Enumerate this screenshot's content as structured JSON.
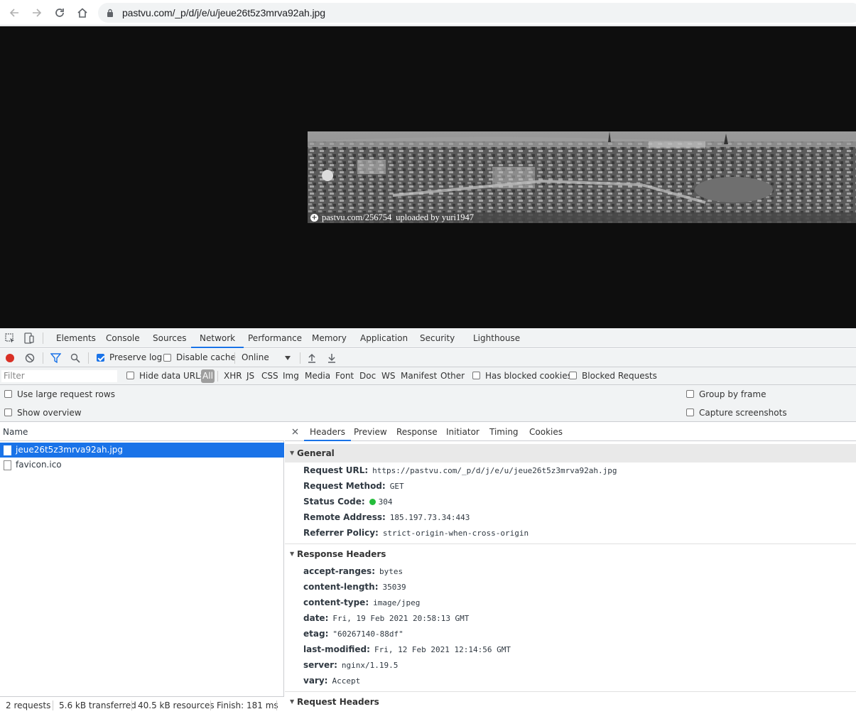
{
  "browser": {
    "url": "pastvu.com/_p/d/j/e/u/jeue26t5z3mrva92ah.jpg"
  },
  "photo": {
    "caption_site": "pastvu.com/256754",
    "caption_uploader": "uploaded by yuri1947"
  },
  "devtools": {
    "tabs": [
      "Elements",
      "Console",
      "Sources",
      "Network",
      "Performance",
      "Memory",
      "Application",
      "Security",
      "Lighthouse"
    ],
    "active_tab": "Network",
    "toolbar": {
      "preserve_log": "Preserve log",
      "disable_cache": "Disable cache",
      "throttle": "Online"
    },
    "filterbar": {
      "placeholder": "Filter",
      "hide_data_urls": "Hide data URLs",
      "types": [
        "All",
        "XHR",
        "JS",
        "CSS",
        "Img",
        "Media",
        "Font",
        "Doc",
        "WS",
        "Manifest",
        "Other"
      ],
      "has_blocked_cookies": "Has blocked cookies",
      "blocked_requests": "Blocked Requests"
    },
    "options": {
      "large_rows": "Use large request rows",
      "show_overview": "Show overview",
      "group_by_frame": "Group by frame",
      "capture_screenshots": "Capture screenshots"
    },
    "requests": {
      "column_name": "Name",
      "rows": [
        "jeue26t5z3mrva92ah.jpg",
        "favicon.ico"
      ],
      "summary": {
        "requests": "2 requests",
        "transferred": "5.6 kB transferred",
        "resources": "40.5 kB resources",
        "finish": "Finish: 181 ms"
      }
    },
    "details": {
      "tabs": [
        "Headers",
        "Preview",
        "Response",
        "Initiator",
        "Timing",
        "Cookies"
      ],
      "general_title": "General",
      "general": [
        {
          "k": "Request URL:",
          "v": "https://pastvu.com/_p/d/j/e/u/jeue26t5z3mrva92ah.jpg"
        },
        {
          "k": "Request Method:",
          "v": "GET"
        },
        {
          "k": "Status Code:",
          "v": "304"
        },
        {
          "k": "Remote Address:",
          "v": "185.197.73.34:443"
        },
        {
          "k": "Referrer Policy:",
          "v": "strict-origin-when-cross-origin"
        }
      ],
      "response_title": "Response Headers",
      "response": [
        {
          "k": "accept-ranges:",
          "v": "bytes"
        },
        {
          "k": "content-length:",
          "v": "35039"
        },
        {
          "k": "content-type:",
          "v": "image/jpeg"
        },
        {
          "k": "date:",
          "v": "Fri, 19 Feb 2021 20:58:13 GMT"
        },
        {
          "k": "etag:",
          "v": "\"60267140-88df\""
        },
        {
          "k": "last-modified:",
          "v": "Fri, 12 Feb 2021 12:14:56 GMT"
        },
        {
          "k": "server:",
          "v": "nginx/1.19.5"
        },
        {
          "k": "vary:",
          "v": "Accept"
        }
      ],
      "request_title": "Request Headers"
    }
  }
}
